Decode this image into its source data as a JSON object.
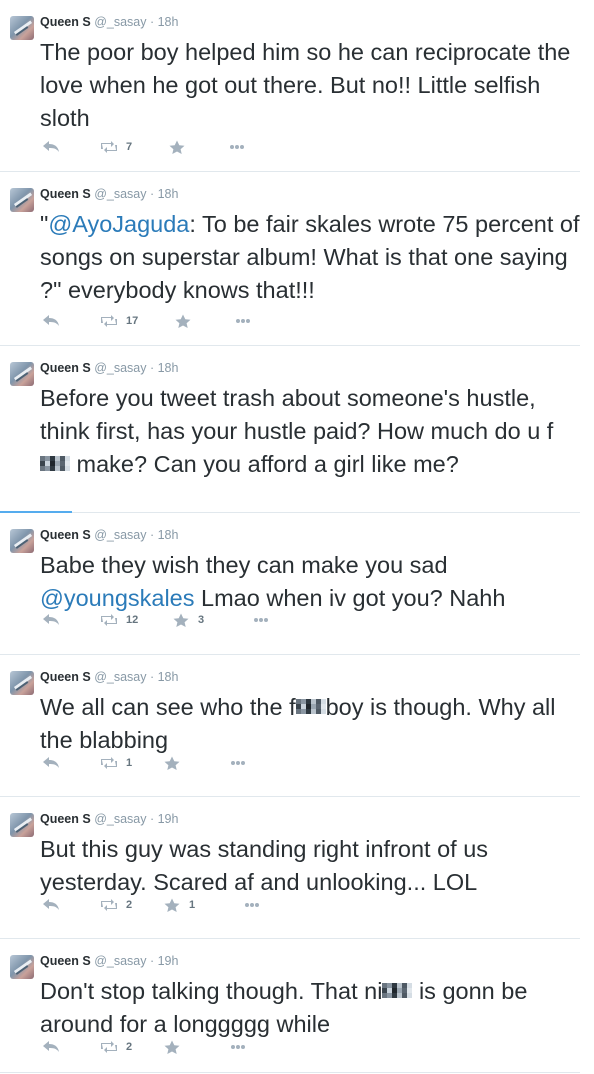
{
  "tweets": [
    {
      "name": "Queen S",
      "handle": "@_sasay",
      "time": "18h",
      "text_parts": [
        {
          "t": "The poor boy helped him so he can reciprocate the love when he got out there. But no!! Little selfish sloth"
        }
      ],
      "retweets": "7",
      "favorites": ""
    },
    {
      "name": "Queen S",
      "handle": "@_sasay",
      "time": "18h",
      "text_parts": [
        {
          "t": "\""
        },
        {
          "t": "@AyoJaguda",
          "mention": true
        },
        {
          "t": ": To be fair skales wrote 75 percent of songs on superstar album! What is that one saying ?\" everybody knows that!!!"
        }
      ],
      "retweets": "17",
      "favorites": ""
    },
    {
      "name": "Queen S",
      "handle": "@_sasay",
      "time": "18h",
      "text_parts": [
        {
          "t": "Before you tweet trash about someone's hustle, think first, has your hustle paid? How much do u f"
        },
        {
          "censor": true
        },
        {
          "t": " make? Can you afford a girl like me?"
        }
      ],
      "retweets": "",
      "favorites": ""
    },
    {
      "name": "Queen S",
      "handle": "@_sasay",
      "time": "18h",
      "text_parts": [
        {
          "t": "Babe they wish they can make you sad "
        },
        {
          "t": "@youngskales",
          "mention": true
        },
        {
          "t": " Lmao when iv got you? Nahh"
        }
      ],
      "retweets": "12",
      "favorites": "3"
    },
    {
      "name": "Queen S",
      "handle": "@_sasay",
      "time": "18h",
      "text_parts": [
        {
          "t": "We all can see who the f"
        },
        {
          "censor": true
        },
        {
          "t": "boy is though. Why all the blabbing"
        }
      ],
      "retweets": "1",
      "favorites": ""
    },
    {
      "name": "Queen S",
      "handle": "@_sasay",
      "time": "19h",
      "text_parts": [
        {
          "t": "But this guy was standing right infront of us yesterday. Scared af and unlooking... LOL"
        }
      ],
      "retweets": "2",
      "favorites": "1"
    },
    {
      "name": "Queen S",
      "handle": "@_sasay",
      "time": "19h",
      "text_parts": [
        {
          "t": "Don't stop talking though. That ni"
        },
        {
          "censor": true
        },
        {
          "t": " is gonn be around for a longgggg while"
        }
      ],
      "retweets": "2",
      "favorites": ""
    }
  ],
  "icons": {
    "reply": "reply-icon",
    "retweet": "retweet-icon",
    "favorite": "star-icon",
    "more": "more-icon"
  },
  "colors": {
    "text": "#292f33",
    "meta": "#8899a6",
    "mention": "#2b7bb9",
    "icon": "#a4b1bd",
    "divider": "#e1e8ed",
    "accent": "#55acee"
  }
}
